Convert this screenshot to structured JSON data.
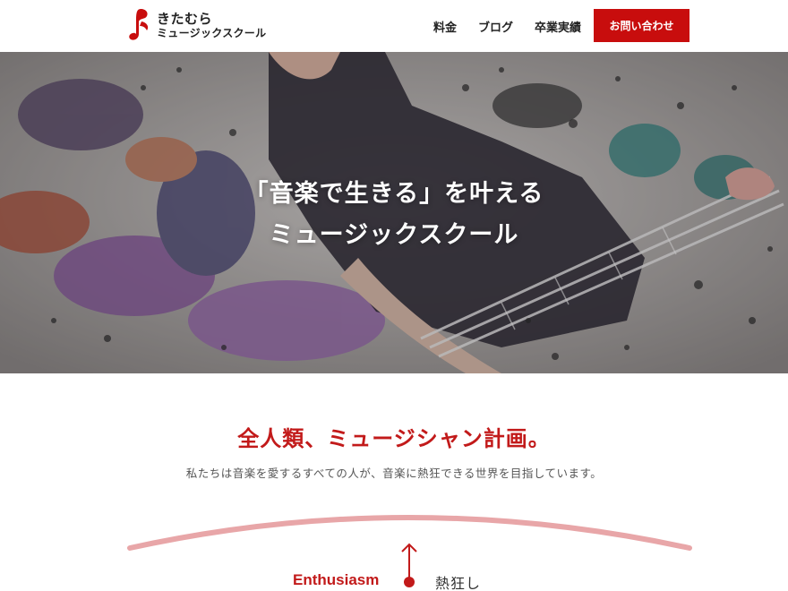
{
  "header": {
    "logo_line1": "きたむら",
    "logo_line2": "ミュージックスクール",
    "nav": [
      {
        "label": "料金"
      },
      {
        "label": "ブログ"
      },
      {
        "label": "卒業実績"
      }
    ],
    "contact_label": "お問い合わせ"
  },
  "hero": {
    "title_line1": "「音楽で生きる」を叶える",
    "title_line2": "ミュージックスクール"
  },
  "mission": {
    "title": "全人類、ミュージシャン計画。",
    "description": "私たちは音楽を愛するすべての人が、音楽に熱狂できる世界を目指しています。"
  },
  "values": {
    "en": "Enthusiasm",
    "jp": "熱狂し"
  },
  "colors": {
    "accent": "#c80d0d",
    "heading": "#c21a1a",
    "arc": "#e8a6a8"
  }
}
